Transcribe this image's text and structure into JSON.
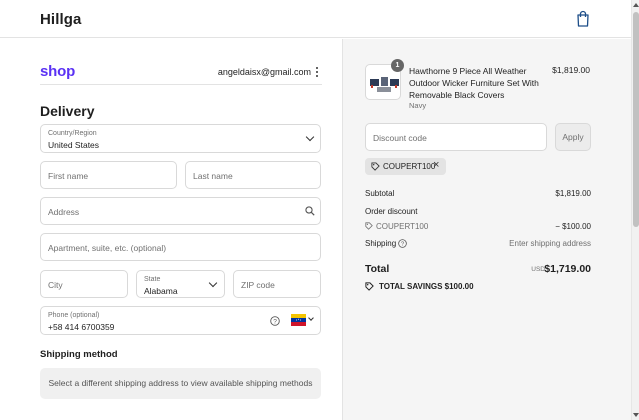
{
  "header": {
    "brand": "Hillga",
    "cart_icon": "shopping-bag-icon"
  },
  "checkout": {
    "shop_logo": "shop",
    "account_email": "angeldaisx@gmail.com",
    "delivery_title": "Delivery",
    "country": {
      "label": "Country/Region",
      "value": "United States"
    },
    "first_name": {
      "placeholder": "First name"
    },
    "last_name": {
      "placeholder": "Last name"
    },
    "address": {
      "placeholder": "Address"
    },
    "apartment": {
      "placeholder": "Apartment, suite, etc. (optional)"
    },
    "city": {
      "placeholder": "City"
    },
    "state": {
      "label": "State",
      "value": "Alabama"
    },
    "zip": {
      "placeholder": "ZIP code"
    },
    "phone": {
      "label": "Phone (optional)",
      "value": "+58 414 6700359",
      "flag": "venezuela-flag-icon"
    },
    "shipping_method_title": "Shipping method",
    "shipping_method_message": "Select a different shipping address to view available shipping methods"
  },
  "summary": {
    "product": {
      "quantity": "1",
      "name": "Hawthorne 9 Piece All Weather Outdoor Wicker Furniture Set With Removable Black Covers",
      "variant": "Navy",
      "price": "$1,819.00"
    },
    "discount_placeholder": "Discount code",
    "apply_label": "Apply",
    "applied_code": "COUPERT100",
    "subtotal_label": "Subtotal",
    "subtotal_value": "$1,819.00",
    "order_discount_label": "Order discount",
    "discount_code": "COUPERT100",
    "discount_value": "− $100.00",
    "shipping_label": "Shipping",
    "shipping_value": "Enter shipping address",
    "total_label": "Total",
    "currency": "USD",
    "total_value": "$1,719.00",
    "savings_label": "TOTAL SAVINGS",
    "savings_value": "$100.00"
  },
  "colors": {
    "shop_brand": "#5a31f4",
    "summary_bg": "#f5f5f5",
    "border": "#d9d9d9"
  }
}
